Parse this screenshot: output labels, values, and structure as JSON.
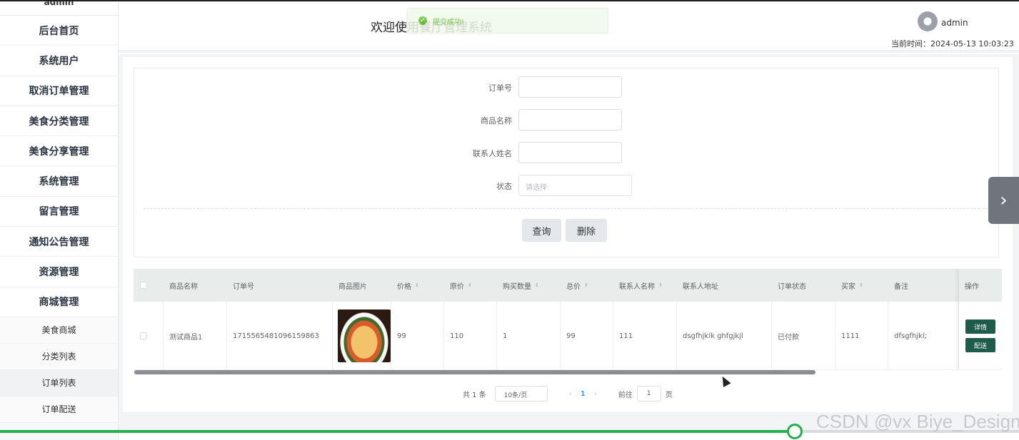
{
  "sidebar": {
    "user": "admin",
    "items": [
      {
        "label": "后台首页"
      },
      {
        "label": "系统用户"
      },
      {
        "label": "取消订单管理"
      },
      {
        "label": "美食分类管理"
      },
      {
        "label": "美食分享管理"
      },
      {
        "label": "系统管理"
      },
      {
        "label": "留言管理"
      },
      {
        "label": "通知公告管理"
      },
      {
        "label": "资源管理"
      },
      {
        "label": "商城管理"
      }
    ],
    "sub_items": [
      {
        "label": "美食商城"
      },
      {
        "label": "分类列表"
      },
      {
        "label": "订单列表"
      },
      {
        "label": "订单配送"
      }
    ]
  },
  "header": {
    "title": "欢迎使用餐厅管理系统",
    "toast": "提交成功!",
    "admin": "admin",
    "time_label": "当前时间：",
    "time_value": "2024-05-13 10:03:23"
  },
  "search": {
    "fields": [
      {
        "label": "订单号",
        "value": "",
        "placeholder": ""
      },
      {
        "label": "商品名称",
        "value": "",
        "placeholder": ""
      },
      {
        "label": "联系人姓名",
        "value": "",
        "placeholder": ""
      },
      {
        "label": "状态",
        "value": "",
        "placeholder": "请选择"
      }
    ],
    "query_button": "查询",
    "delete_button": "删除"
  },
  "table": {
    "columns": [
      "商品名称",
      "订单号",
      "商品图片",
      "价格",
      "原价",
      "购买数量",
      "总价",
      "联系人名称",
      "联系人地址",
      "订单状态",
      "买家",
      "备注",
      "操作"
    ],
    "rows": [
      {
        "name": "测试商品1",
        "order_no": "1715565481096159863",
        "price": "99",
        "original_price": "110",
        "quantity": "1",
        "total": "99",
        "contact": "111",
        "address": "dsgfhjklk ghfgjkjl",
        "status": "已付款",
        "buyer": "1111",
        "note": "dfsgfhjkl;",
        "actions": [
          "详情",
          "配送"
        ]
      }
    ]
  },
  "pagination": {
    "total": "共 1 条",
    "page_size": "10条/页",
    "current_page": "1",
    "goto_label": "前往",
    "goto_value": "1",
    "page_unit": "页"
  },
  "video": {
    "progress": 0.78
  },
  "watermark": "CSDN @vx Biye_Design",
  "colors": {
    "accent": "#1e5b4a",
    "success": "#67c23a",
    "progress": "#22b14c",
    "link": "#409eff"
  }
}
